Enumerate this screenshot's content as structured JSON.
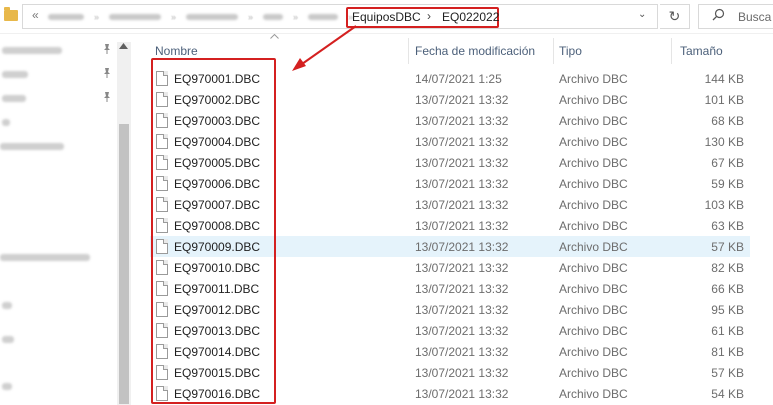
{
  "address": {
    "crumb_1": "EquiposDBC",
    "crumb_2": "EQ022022",
    "separator": "›",
    "dropdown": "⌄",
    "back_chevron": "«",
    "refresh_glyph": "↻",
    "search_placeholder": "Busca"
  },
  "columns": {
    "name": "Nombre",
    "date": "Fecha de modificación",
    "type": "Tipo",
    "size": "Tamaño"
  },
  "files": [
    {
      "name": "EQ970001.DBC",
      "date": "14/07/2021 1:25",
      "type": "Archivo DBC",
      "size": "144 KB"
    },
    {
      "name": "EQ970002.DBC",
      "date": "13/07/2021 13:32",
      "type": "Archivo DBC",
      "size": "101 KB"
    },
    {
      "name": "EQ970003.DBC",
      "date": "13/07/2021 13:32",
      "type": "Archivo DBC",
      "size": "68 KB"
    },
    {
      "name": "EQ970004.DBC",
      "date": "13/07/2021 13:32",
      "type": "Archivo DBC",
      "size": "130 KB"
    },
    {
      "name": "EQ970005.DBC",
      "date": "13/07/2021 13:32",
      "type": "Archivo DBC",
      "size": "67 KB"
    },
    {
      "name": "EQ970006.DBC",
      "date": "13/07/2021 13:32",
      "type": "Archivo DBC",
      "size": "59 KB"
    },
    {
      "name": "EQ970007.DBC",
      "date": "13/07/2021 13:32",
      "type": "Archivo DBC",
      "size": "103 KB"
    },
    {
      "name": "EQ970008.DBC",
      "date": "13/07/2021 13:32",
      "type": "Archivo DBC",
      "size": "63 KB"
    },
    {
      "name": "EQ970009.DBC",
      "date": "13/07/2021 13:32",
      "type": "Archivo DBC",
      "size": "57 KB"
    },
    {
      "name": "EQ970010.DBC",
      "date": "13/07/2021 13:32",
      "type": "Archivo DBC",
      "size": "82 KB"
    },
    {
      "name": "EQ970011.DBC",
      "date": "13/07/2021 13:32",
      "type": "Archivo DBC",
      "size": "66 KB"
    },
    {
      "name": "EQ970012.DBC",
      "date": "13/07/2021 13:32",
      "type": "Archivo DBC",
      "size": "95 KB"
    },
    {
      "name": "EQ970013.DBC",
      "date": "13/07/2021 13:32",
      "type": "Archivo DBC",
      "size": "61 KB"
    },
    {
      "name": "EQ970014.DBC",
      "date": "13/07/2021 13:32",
      "type": "Archivo DBC",
      "size": "81 KB"
    },
    {
      "name": "EQ970015.DBC",
      "date": "13/07/2021 13:32",
      "type": "Archivo DBC",
      "size": "57 KB"
    },
    {
      "name": "EQ970016.DBC",
      "date": "13/07/2021 13:32",
      "type": "Archivo DBC",
      "size": "54 KB"
    }
  ],
  "selected_file": "EQ970009.DBC",
  "colors": {
    "highlight_red": "#d42020",
    "selected_row": "#e5f3fb",
    "header_text": "#4c607a",
    "folder": "#e8b84a"
  },
  "icons": {
    "pin": "📌",
    "sort_up": "⌃",
    "scroll_up": "▲",
    "search": "⌕"
  }
}
